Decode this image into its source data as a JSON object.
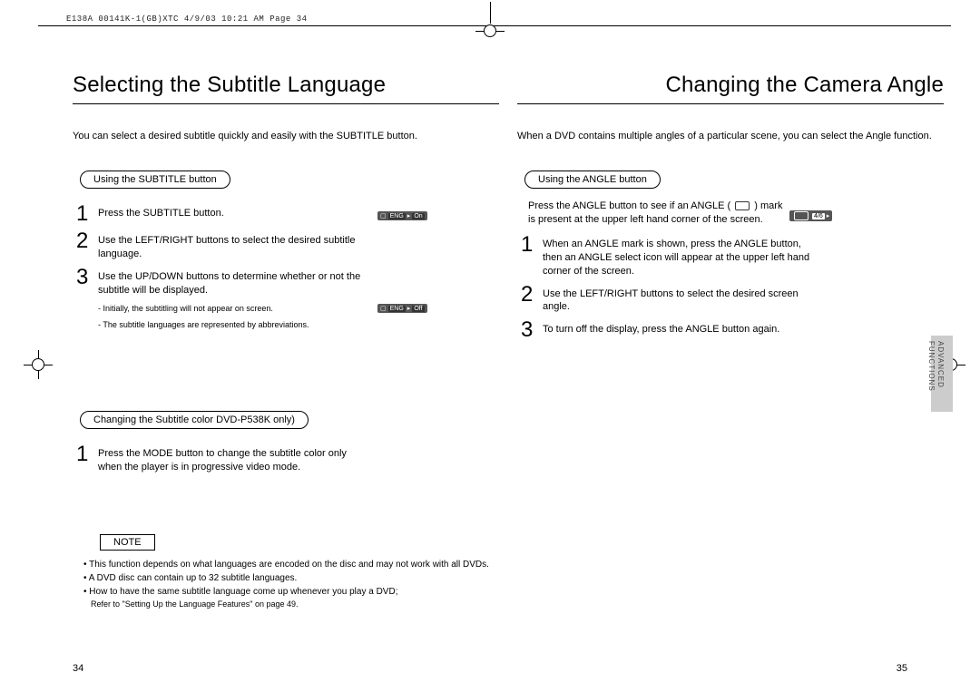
{
  "header": "E138A 00141K-1(GB)XTC  4/9/03 10:21 AM  Page 34",
  "left": {
    "title": "Selecting the Subtitle Language",
    "intro": "You can select a desired subtitle quickly and easily with the SUBTITLE button.",
    "pill1": "Using the SUBTITLE button",
    "step1": "Press the SUBTITLE button.",
    "step2": "Use the LEFT/RIGHT buttons to select the desired subtitle language.",
    "step3": "Use the UP/DOWN buttons to determine whether or not the subtitle will be displayed.",
    "mini1": "- Initially, the subtitling will not appear on screen.",
    "mini2": "- The subtitle languages are represented by abbreviations.",
    "pill2": "Changing the Subtitle color      DVD-P538K only)",
    "step1b": "Press the MODE button to change the subtitle color only when the player is in progressive video mode.",
    "note_label": "NOTE",
    "note1": "This function depends on what languages are encoded on the disc and may not work with all DVDs.",
    "note2": "A DVD disc can contain up to 32 subtitle languages.",
    "note3": "How to have the same subtitle language come up whenever you play  a DVD;",
    "note3b": "Refer to \"Setting Up the Language Features\" on page 49.",
    "pagenum": "34"
  },
  "right": {
    "title": "Changing the Camera Angle",
    "intro": "When a DVD contains multiple angles of a particular scene, you can select the Angle function.",
    "pill1": "Using the ANGLE button",
    "pre1": "Press the ANGLE button to see if an ANGLE (        ) mark is present at the upper left hand corner of the screen.",
    "step1": "When an ANGLE mark is shown, press the ANGLE button, then an ANGLE select icon will appear at the upper left hand corner of the screen.",
    "step2": "Use the LEFT/RIGHT buttons to select the desired screen angle.",
    "step3": "To turn off the display, press the ANGLE button again.",
    "pagenum": "35",
    "tab1": "ADVANCED",
    "tab2": "FUNCTIONS"
  },
  "osd": {
    "sub_eng": "ENG",
    "sub_on": "On",
    "sub_off": "Off",
    "angle": "4/6"
  }
}
